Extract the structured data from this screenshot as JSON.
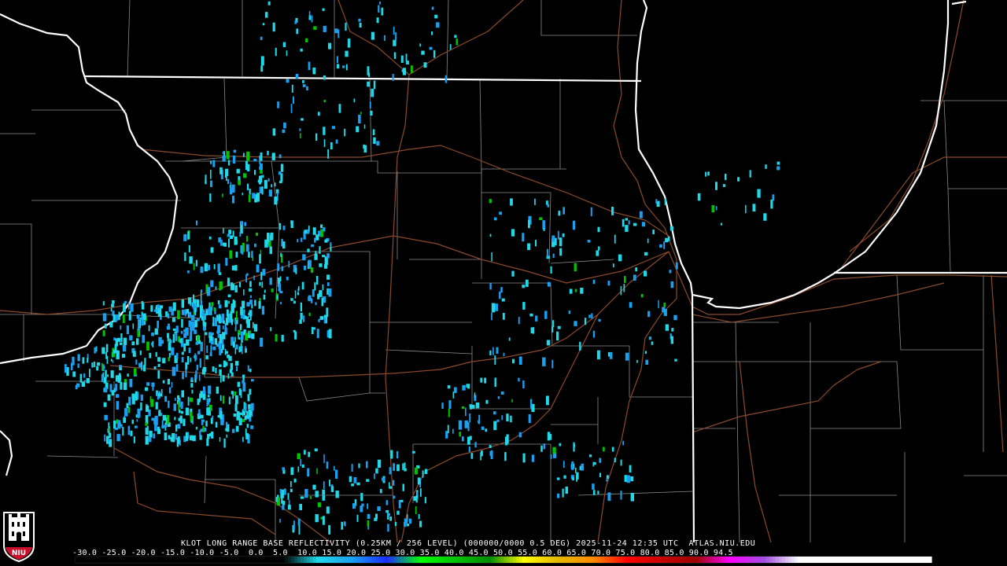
{
  "caption": "KLOT LONG RANGE BASE REFLECTIVITY (0.25KM / 256 LEVEL) (000000/0000 0.5 DEG) 2025-11-24 12:35 UTC  ATLAS.NIU.EDU",
  "scale": {
    "labels": "-30.0 -25.0 -20.0 -15.0 -10.0 -5.0  0.0  5.0  10.0 15.0 20.0 25.0 30.0 35.0 40.0 45.0 50.0 55.0 60.0 65.0 70.0 75.0 80.0 85.0 90.0 94.5",
    "stops": [
      {
        "dbz": -30,
        "color": "#000000"
      },
      {
        "dbz": 0,
        "color": "#000000"
      },
      {
        "dbz": 5,
        "color": "#1fd8e8"
      },
      {
        "dbz": 10,
        "color": "#1aa0f0"
      },
      {
        "dbz": 15,
        "color": "#1a2cff"
      },
      {
        "dbz": 20,
        "color": "#00ff00"
      },
      {
        "dbz": 25,
        "color": "#00c400"
      },
      {
        "dbz": 30,
        "color": "#008c00"
      },
      {
        "dbz": 35,
        "color": "#ffff00"
      },
      {
        "dbz": 40,
        "color": "#e6b800"
      },
      {
        "dbz": 45,
        "color": "#ff8c00"
      },
      {
        "dbz": 50,
        "color": "#ff0000"
      },
      {
        "dbz": 55,
        "color": "#c80000"
      },
      {
        "dbz": 60,
        "color": "#a00000"
      },
      {
        "dbz": 65,
        "color": "#ff00ff"
      },
      {
        "dbz": 70,
        "color": "#a050e0"
      },
      {
        "dbz": 75,
        "color": "#ffffff"
      },
      {
        "dbz": 94.5,
        "color": "#ffffff"
      }
    ]
  },
  "logo": {
    "text": "NIU",
    "color": "#c8102e"
  },
  "colors": {
    "state_border": "#ffffff",
    "county_line": "#8a8a8a",
    "highway": "#8b4a2b",
    "echo_light": "#1fd8e8",
    "echo_medium": "#1aa0f0",
    "echo_strong": "#00c400"
  }
}
